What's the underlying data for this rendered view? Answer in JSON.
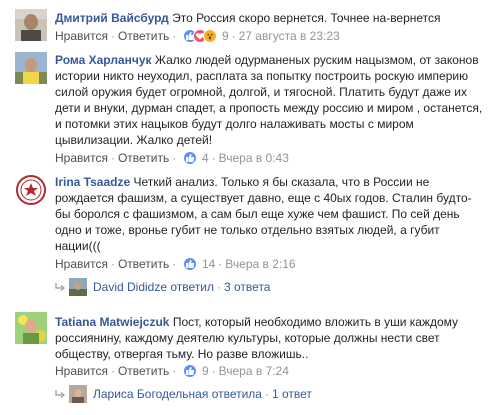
{
  "comments": [
    {
      "author": "Дмитрий Вайсбурд",
      "lines": [
        "Это Россия скоро вернется. Точнее на-вернется"
      ],
      "like": "Нравится",
      "reply": "Ответить",
      "reactions": [
        "like",
        "love",
        "wow"
      ],
      "count": "9",
      "time": "27 августа в 23:23"
    },
    {
      "author": "Рома Харланчук",
      "lines": [
        "Жалко людей одурманеных руским нацызмом, от законов",
        "истории никто неуходил, расплата за попытку построить роскую империю",
        "силой оружия будет огромной, долгой, и тягосной. Платить будут даже их",
        "дети и внуки, дурман спадет, а пропость между россию и миром , останется,",
        "и потомки этих нацыков будут долго налаживать мосты с миром",
        "цывилизации. Жалко детей!"
      ],
      "like": "Нравится",
      "reply": "Ответить",
      "reactions": [
        "like"
      ],
      "count": "4",
      "time": "Вчера в 0:43"
    },
    {
      "author": "Irina Tsaadze",
      "lines": [
        "Четкий анализ. Только я бы сказала, что в России не",
        "рождается фашизм, а существует давно, еще с 40ых годов. Сталин будто-",
        "бы боролся с фашизмом, а сам был еще хуже чем фашист. По сей день",
        "одно и тоже, вроньe губит не только отдельно взятых людей, а губит",
        "нации((("
      ],
      "like": "Нравится",
      "reply": "Ответить",
      "reactions": [
        "like"
      ],
      "count": "14",
      "time": "Вчера в 2:16",
      "replies": {
        "who": "David Dididze",
        "verb": "ответил",
        "count": "3 ответа"
      }
    },
    {
      "author": "Tatiana Matwiejczuk",
      "lines": [
        "Пост, который необходимо вложить в уши каждому",
        "россиянину, каждому деятелю культуры, которые должны нести свет",
        "обществу, отвергая тьму. Но разве вложишь.."
      ],
      "like": "Нравится",
      "reply": "Ответить",
      "reactions": [
        "like"
      ],
      "count": "9",
      "time": "Вчера в 7:24",
      "replies": {
        "who": "Лариса Богодельная",
        "verb": "ответила",
        "count": "1 ответ"
      }
    }
  ],
  "colors": {
    "link": "#365899",
    "text": "#1d2129",
    "meta": "#90949c",
    "like": "#5890ff",
    "love": "#f25268",
    "wow": "#f7b125"
  },
  "icons": [
    "thumbs-up-icon",
    "heart-icon",
    "wow-icon",
    "reply-arrow-icon"
  ]
}
